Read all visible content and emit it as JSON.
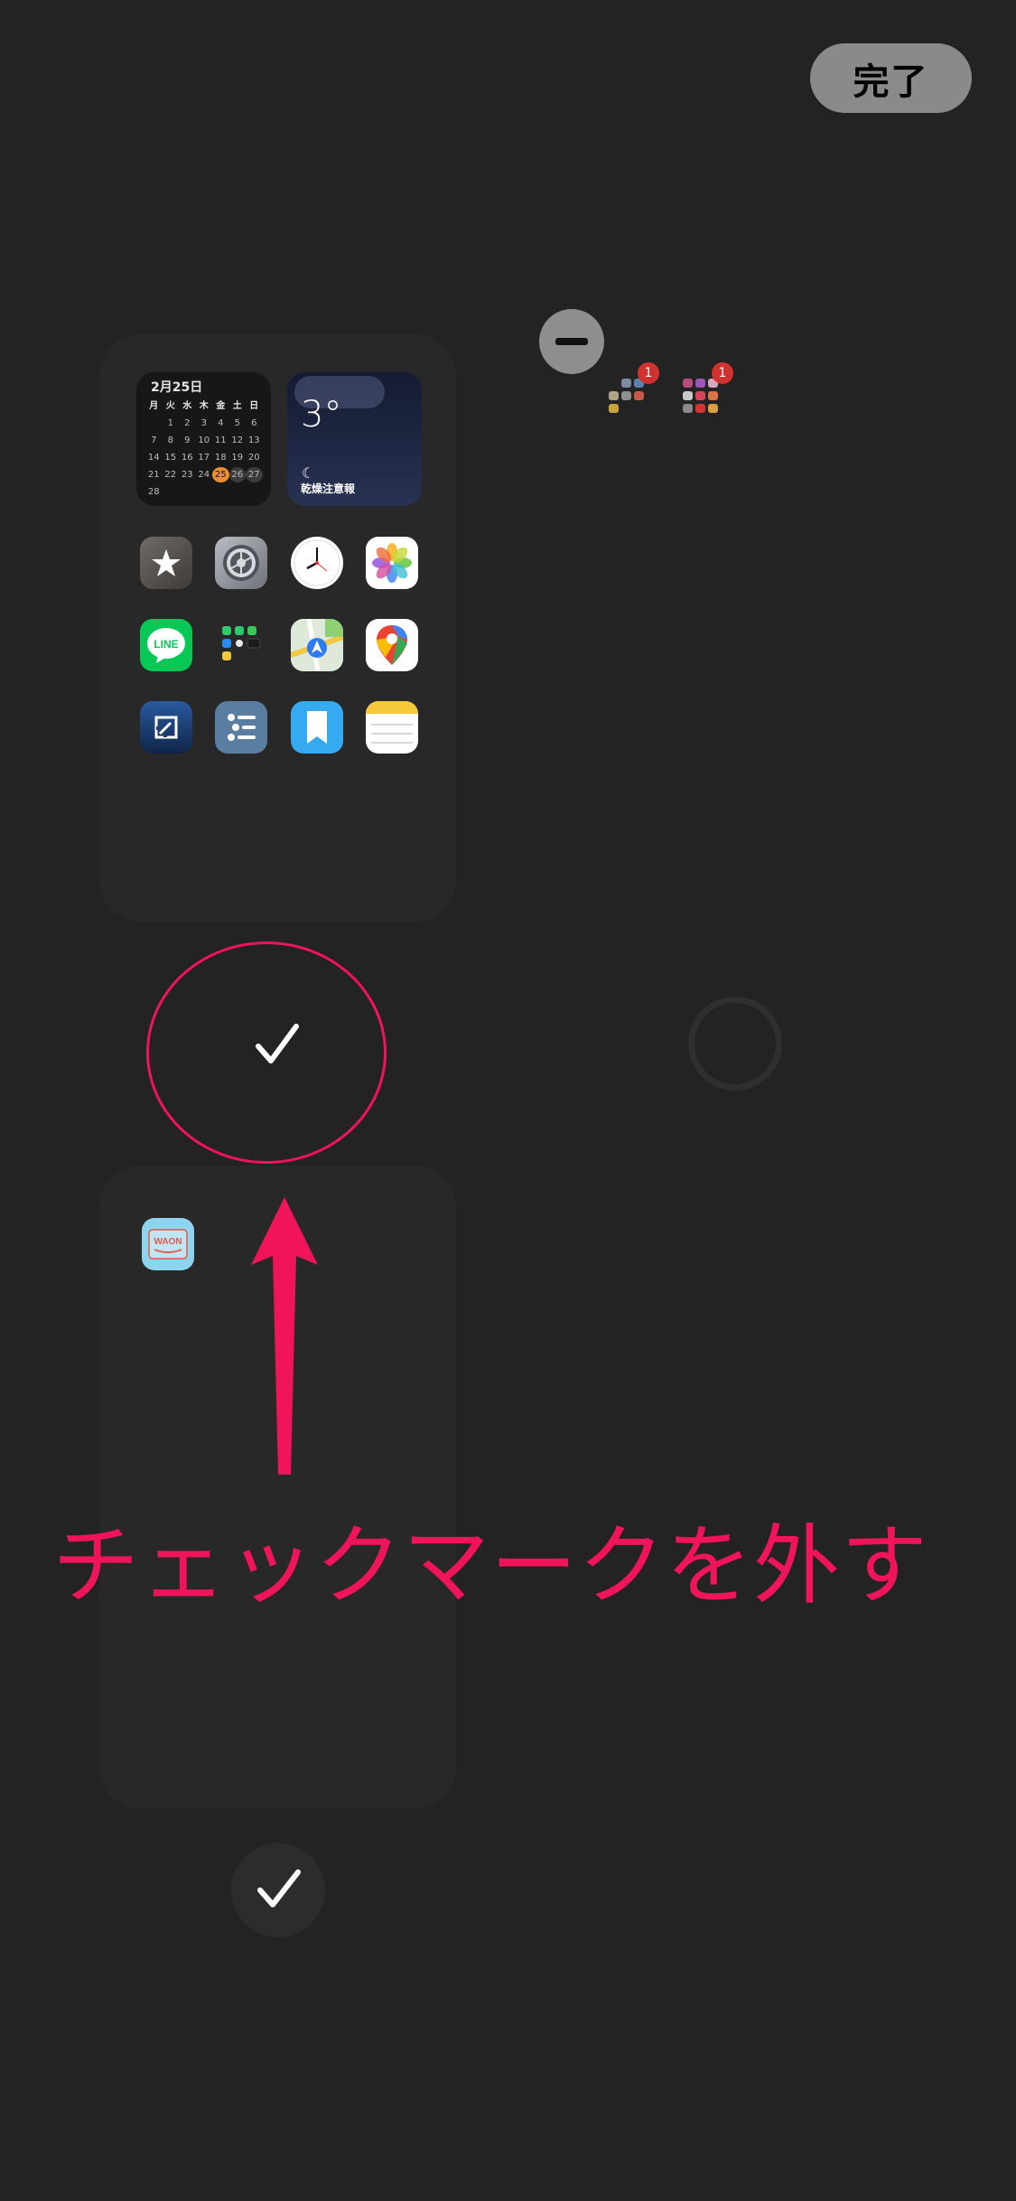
{
  "header": {
    "done_label": "完了"
  },
  "calendar_widget": {
    "title": "2月25日",
    "weekdays": [
      "月",
      "火",
      "水",
      "木",
      "金",
      "土",
      "日"
    ],
    "days": [
      "",
      "1",
      "2",
      "3",
      "4",
      "5",
      "6",
      "7",
      "8",
      "9",
      "10",
      "11",
      "12",
      "13",
      "14",
      "15",
      "16",
      "17",
      "18",
      "19",
      "20",
      "21",
      "22",
      "23",
      "24",
      "25",
      "26",
      "27",
      "28"
    ]
  },
  "weather_widget": {
    "temperature": "3°",
    "alert": "乾燥注意報"
  },
  "apps": {
    "row1": [
      "itunes-store-icon",
      "settings-icon",
      "clock-icon",
      "photos-icon"
    ],
    "row2": [
      "line-icon",
      "app-folder-icon",
      "maps-icon",
      "google-maps-icon"
    ],
    "row3": [
      "shortcut-app-icon",
      "reminders-icon",
      "bookmark-app-icon",
      "notes-icon"
    ],
    "page2": [
      "waon-icon"
    ],
    "line_label": "LINE",
    "waon_label": "WAON"
  },
  "mini_pages": [
    {
      "badge": "1"
    },
    {
      "badge": "1"
    }
  ],
  "annotation": {
    "text": "チェックマークを外す",
    "color": "#f0145a"
  }
}
